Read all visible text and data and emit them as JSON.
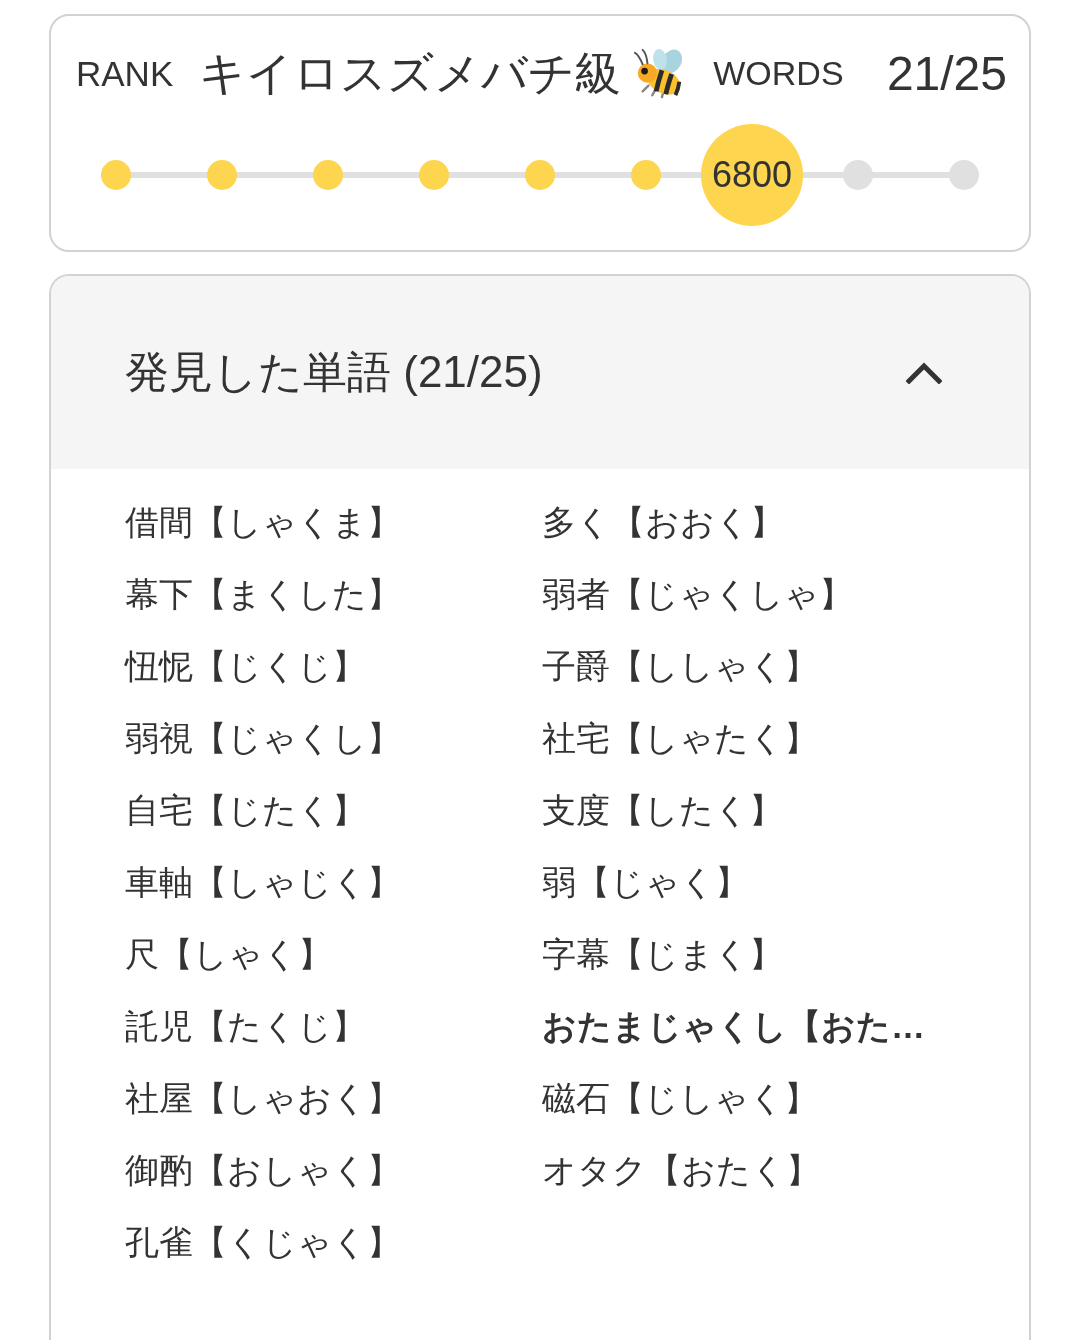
{
  "rank_card": {
    "rank_label": "RANK",
    "rank_name": "キイロスズメバチ級",
    "words_label": "WORDS",
    "words_count": "21/25",
    "progress": [
      {
        "reached": true,
        "current": false
      },
      {
        "reached": true,
        "current": false
      },
      {
        "reached": true,
        "current": false
      },
      {
        "reached": true,
        "current": false
      },
      {
        "reached": true,
        "current": false
      },
      {
        "reached": true,
        "current": false
      },
      {
        "reached": true,
        "current": true,
        "label": "6800"
      },
      {
        "reached": false,
        "current": false
      },
      {
        "reached": false,
        "current": false
      }
    ]
  },
  "found_words": {
    "title": "発見した単語 (21/25)",
    "expanded": true,
    "words": [
      {
        "text": "借間【しゃくま】",
        "emphasized": false
      },
      {
        "text": "幕下【まくした】",
        "emphasized": false
      },
      {
        "text": "忸怩【じくじ】",
        "emphasized": false
      },
      {
        "text": "弱視【じゃくし】",
        "emphasized": false
      },
      {
        "text": "自宅【じたく】",
        "emphasized": false
      },
      {
        "text": "車軸【しゃじく】",
        "emphasized": false
      },
      {
        "text": "尺【しゃく】",
        "emphasized": false
      },
      {
        "text": "託児【たくじ】",
        "emphasized": false
      },
      {
        "text": "社屋【しゃおく】",
        "emphasized": false
      },
      {
        "text": "御酌【おしゃく】",
        "emphasized": false
      },
      {
        "text": "孔雀【くじゃく】",
        "emphasized": false
      },
      {
        "text": "多く【おおく】",
        "emphasized": false
      },
      {
        "text": "弱者【じゃくしゃ】",
        "emphasized": false
      },
      {
        "text": "子爵【ししゃく】",
        "emphasized": false
      },
      {
        "text": "社宅【しゃたく】",
        "emphasized": false
      },
      {
        "text": "支度【したく】",
        "emphasized": false
      },
      {
        "text": "弱【じゃく】",
        "emphasized": false
      },
      {
        "text": "字幕【じまく】",
        "emphasized": false
      },
      {
        "text": "おたまじゃくし【おた…",
        "emphasized": true
      },
      {
        "text": "磁石【じしゃく】",
        "emphasized": false
      },
      {
        "text": "オタク【おたく】",
        "emphasized": false
      }
    ]
  }
}
